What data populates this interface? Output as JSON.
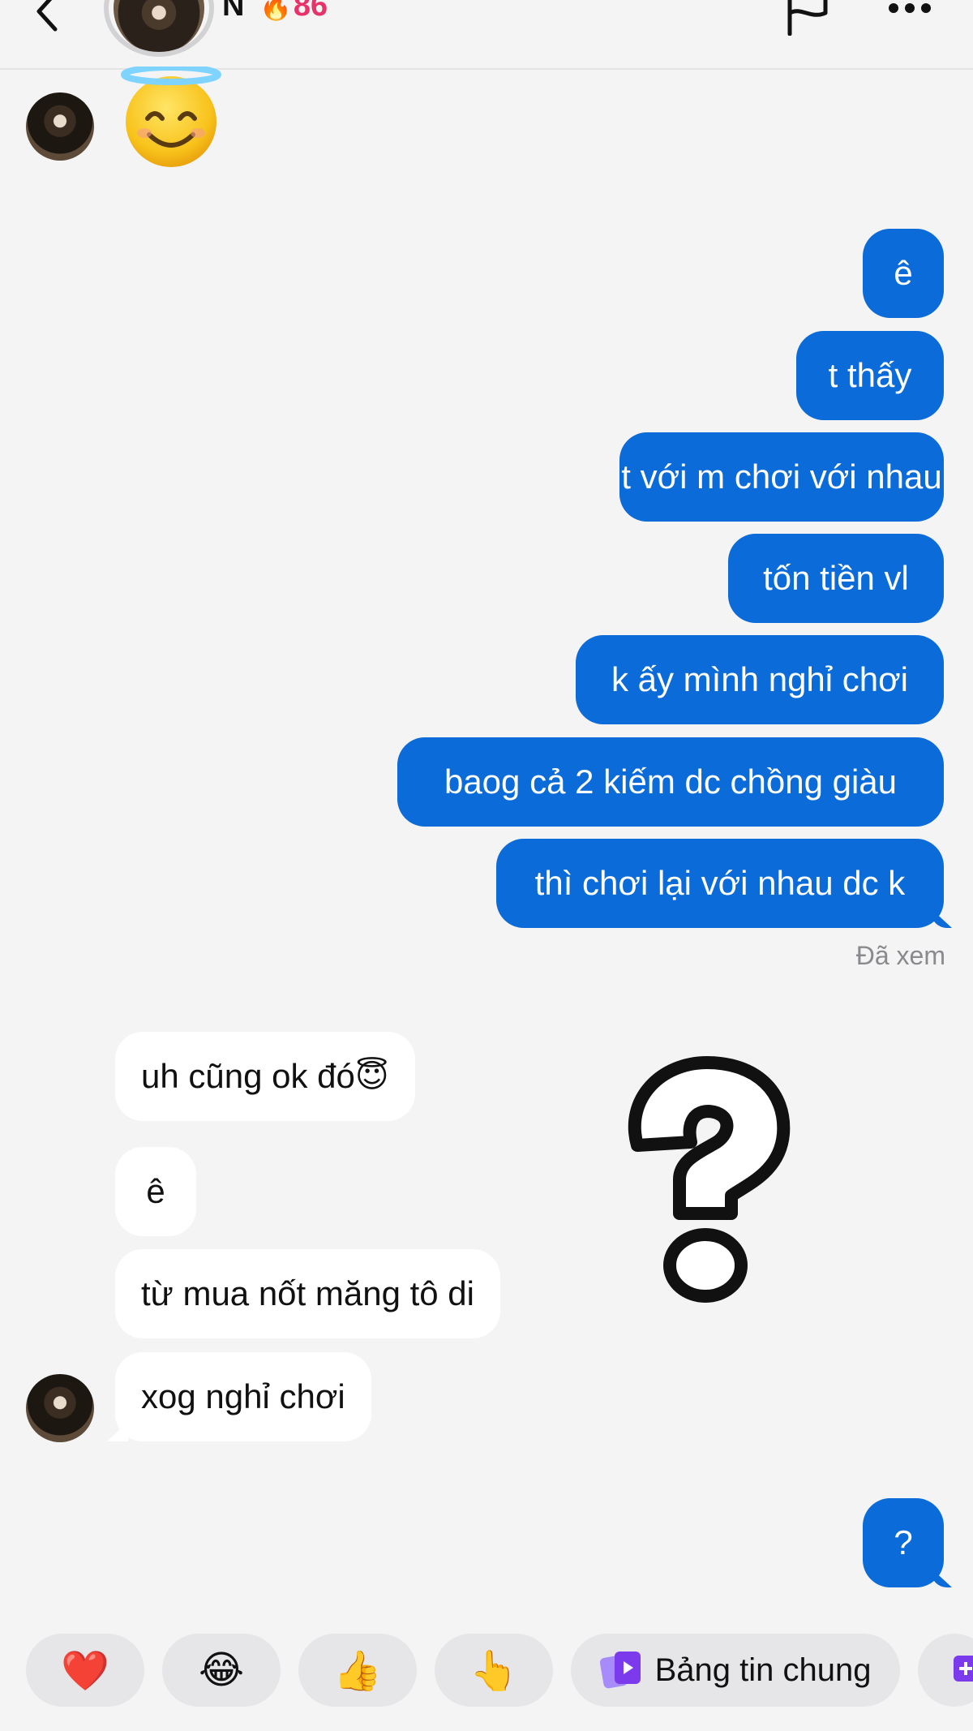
{
  "header": {
    "contact_name": "N",
    "streak_count": "86",
    "streak_icon": "flame-icon"
  },
  "messages": [
    {
      "id": "m1",
      "direction": "in",
      "type": "emoji",
      "content": "😇"
    },
    {
      "id": "m2",
      "direction": "out",
      "text": "ê"
    },
    {
      "id": "m3",
      "direction": "out",
      "text": "t thấy"
    },
    {
      "id": "m4",
      "direction": "out",
      "text": "t với m chơi với nhau"
    },
    {
      "id": "m5",
      "direction": "out",
      "text": "tốn tiền vl"
    },
    {
      "id": "m6",
      "direction": "out",
      "text": "k ấy mình nghỉ chơi"
    },
    {
      "id": "m7",
      "direction": "out",
      "text": "baog cả 2 kiếm dc chồng giàu"
    },
    {
      "id": "m8",
      "direction": "out",
      "text": "thì chơi lại với nhau dc k"
    },
    {
      "id": "m9",
      "direction": "in",
      "text": "uh cũng ok đó",
      "emoji": "😇"
    },
    {
      "id": "m10",
      "direction": "in",
      "text": "ê"
    },
    {
      "id": "m11",
      "direction": "in",
      "text": "từ mua nốt măng tô di"
    },
    {
      "id": "m12",
      "direction": "in",
      "text": "xog nghỉ chơi"
    },
    {
      "id": "m13",
      "direction": "out",
      "text": "?"
    }
  ],
  "seen_status": "Đã xem",
  "quick_reactions": [
    {
      "emoji": "❤️",
      "icon": "heart-icon"
    },
    {
      "emoji": "😂",
      "icon": "laughing-face-icon"
    },
    {
      "emoji": "👍",
      "icon": "thumbs-up-icon"
    },
    {
      "emoji": "👆",
      "icon": "pointing-hand-icon"
    }
  ],
  "stories_button": {
    "label": "Bảng tin chung",
    "icon": "shared-stories-icon"
  },
  "colors": {
    "outgoing_bubble": "#0a6bd9",
    "incoming_bubble": "#ffffff",
    "background": "#f4f4f5",
    "streak": "#e8336a"
  }
}
